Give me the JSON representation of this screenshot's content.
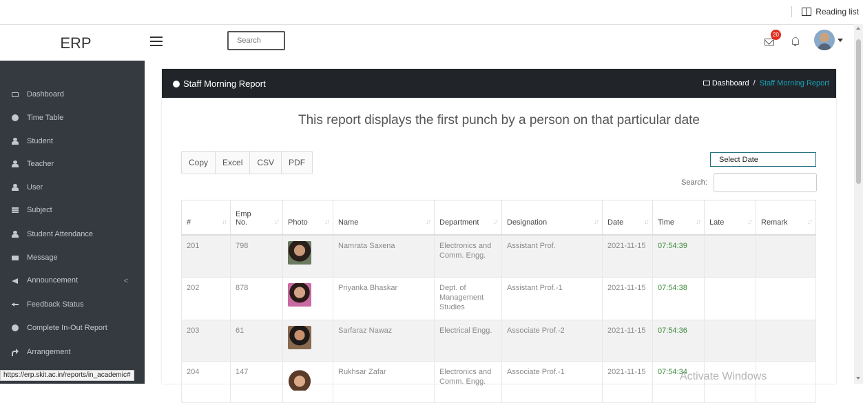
{
  "browser": {
    "reading_list": "Reading list"
  },
  "topbar": {
    "logo": "ERP",
    "search_placeholder": "Search",
    "notifications_count": "20"
  },
  "sidebar": {
    "items": [
      {
        "label": "Dashboard",
        "icon": "monitor-icon"
      },
      {
        "label": "Time Table",
        "icon": "circle-icon"
      },
      {
        "label": "Student",
        "icon": "person-icon"
      },
      {
        "label": "Teacher",
        "icon": "person-icon"
      },
      {
        "label": "User",
        "icon": "users-icon"
      },
      {
        "label": "Subject",
        "icon": "list-icon"
      },
      {
        "label": "Student Attendance",
        "icon": "person-icon"
      },
      {
        "label": "Message",
        "icon": "envelope-icon"
      },
      {
        "label": "Announcement",
        "icon": "megaphone-icon"
      },
      {
        "label": "Feedback Status",
        "icon": "arrows-icon"
      },
      {
        "label": "Complete In-Out Report",
        "icon": "circle-icon"
      },
      {
        "label": "Arrangement",
        "icon": "share-icon"
      }
    ],
    "announcement_chevron": "<"
  },
  "status_url": "https://erp.skit.ac.in/reports/in_academic#",
  "card": {
    "title": "Staff Morning Report",
    "breadcrumb_home": "Dashboard",
    "breadcrumb_sep": "/",
    "breadcrumb_current": "Staff Morning Report",
    "description": "This report displays the first punch by a person on that particular date",
    "buttons": {
      "copy": "Copy",
      "excel": "Excel",
      "csv": "CSV",
      "pdf": "PDF"
    },
    "select_date": "Select Date",
    "search_label": "Search:"
  },
  "table": {
    "columns": [
      "#",
      "Emp No.",
      "Photo",
      "Name",
      "Department",
      "Designation",
      "Date",
      "Time",
      "Late",
      "Remark"
    ],
    "rows": [
      {
        "num": "201",
        "emp": "798",
        "name": "Namrata Saxena",
        "dept": "Electronics and Comm. Engg.",
        "designation": "Assistant Prof.",
        "date": "2021-11-15",
        "time": "07:54:39",
        "late": "",
        "remark": ""
      },
      {
        "num": "202",
        "emp": "878",
        "name": "Priyanka Bhaskar",
        "dept": "Dept. of Management Studies",
        "designation": "Assistant Prof.-1",
        "date": "2021-11-15",
        "time": "07:54:38",
        "late": "",
        "remark": ""
      },
      {
        "num": "203",
        "emp": "61",
        "name": "Sarfaraz Nawaz",
        "dept": "Electrical Engg.",
        "designation": "Associate Prof.-2",
        "date": "2021-11-15",
        "time": "07:54:36",
        "late": "",
        "remark": ""
      },
      {
        "num": "204",
        "emp": "147",
        "name": "Rukhsar Zafar",
        "dept": "Electronics and Comm. Engg.",
        "designation": "Associate Prof.-1",
        "date": "2021-11-15",
        "time": "07:54:34",
        "late": "",
        "remark": ""
      }
    ]
  },
  "watermark": "Activate Windows",
  "colors": {
    "sidebar_bg": "#343a40",
    "header_bg": "#212529",
    "accent": "#17a2b8",
    "time_green": "#3d8b3d"
  }
}
